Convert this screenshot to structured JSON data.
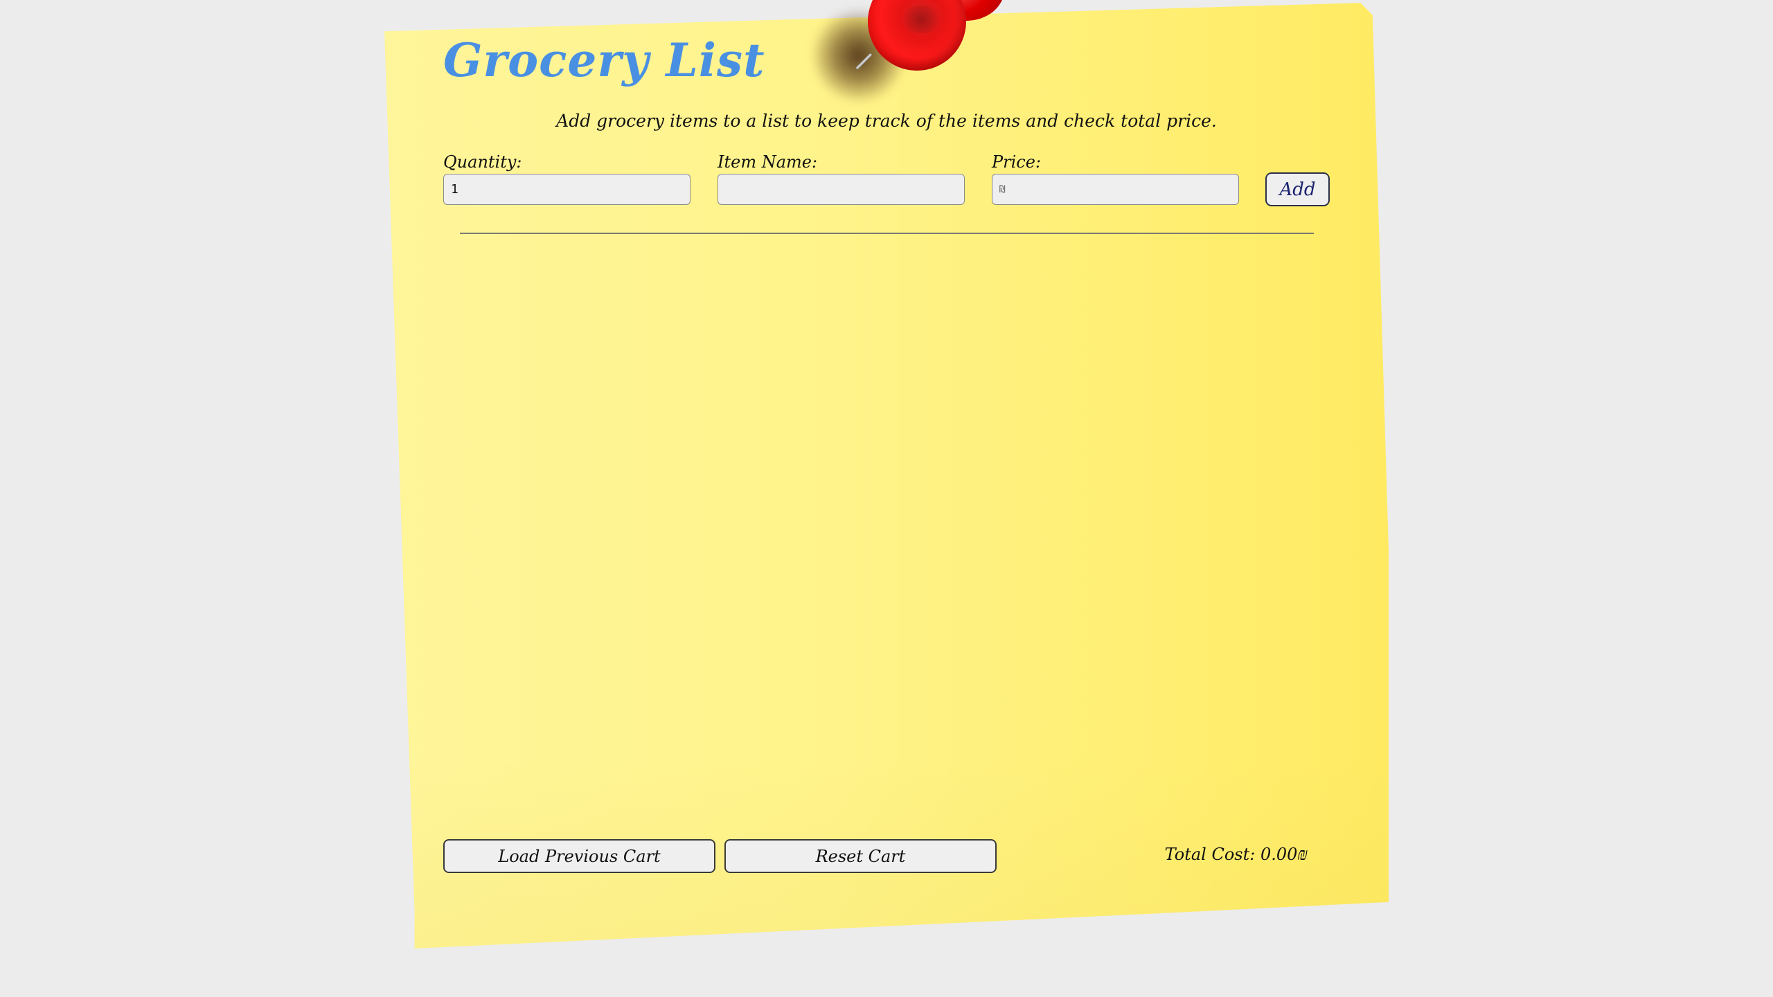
{
  "header": {
    "title": "Grocery List",
    "subtitle": "Add grocery items to a list to keep track of the items and check total price."
  },
  "form": {
    "quantity": {
      "label": "Quantity:",
      "value": "1"
    },
    "item_name": {
      "label": "Item Name:",
      "value": ""
    },
    "price": {
      "label": "Price:",
      "value": "₪"
    },
    "add_label": "Add"
  },
  "items": [],
  "footer": {
    "load_label": "Load Previous Cart",
    "reset_label": "Reset Cart",
    "total_text": "Total Cost: 0.00₪"
  },
  "colors": {
    "title": "#4a90e2",
    "note": "#fff38a",
    "background": "#ececec",
    "pin": "#e81414",
    "add_text": "#1c2370"
  },
  "icons": {
    "pin": "pushpin-icon",
    "currency": "shekel-sign"
  }
}
